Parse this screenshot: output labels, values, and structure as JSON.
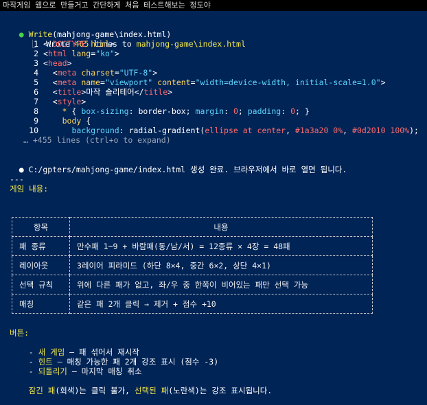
{
  "window": {
    "title": "마작게임 웹으로 만들거고 간단하게 처음 테스트해보는 정도야"
  },
  "tool_call": {
    "name": "Write",
    "arg": "mahjong-game\\index.html",
    "result_prefix": "Wrote ",
    "result_count": "465",
    "result_mid": " lines to ",
    "result_path": "mahjong-game\\index.html"
  },
  "code_lines": [
    {
      "n": "1",
      "parts": [
        {
          "t": "<!",
          "c": "w"
        },
        {
          "t": "DOCTYPE",
          "c": "kw"
        },
        {
          "t": " html",
          "c": "attr"
        },
        {
          "t": ">",
          "c": "w"
        }
      ]
    },
    {
      "n": "2",
      "parts": [
        {
          "t": "<",
          "c": "w"
        },
        {
          "t": "html",
          "c": "kw"
        },
        {
          "t": " lang",
          "c": "attr"
        },
        {
          "t": "=",
          "c": "w"
        },
        {
          "t": "\"ko\"",
          "c": "str"
        },
        {
          "t": ">",
          "c": "w"
        }
      ]
    },
    {
      "n": "3",
      "parts": [
        {
          "t": "<",
          "c": "w"
        },
        {
          "t": "head",
          "c": "kw"
        },
        {
          "t": ">",
          "c": "w"
        }
      ]
    },
    {
      "n": "4",
      "parts": [
        {
          "t": "  <",
          "c": "w"
        },
        {
          "t": "meta",
          "c": "kw"
        },
        {
          "t": " charset",
          "c": "attr"
        },
        {
          "t": "=",
          "c": "w"
        },
        {
          "t": "\"UTF-8\"",
          "c": "str"
        },
        {
          "t": ">",
          "c": "w"
        }
      ]
    },
    {
      "n": "5",
      "parts": [
        {
          "t": "  <",
          "c": "w"
        },
        {
          "t": "meta",
          "c": "kw"
        },
        {
          "t": " name",
          "c": "attr"
        },
        {
          "t": "=",
          "c": "w"
        },
        {
          "t": "\"viewport\"",
          "c": "str"
        },
        {
          "t": " content",
          "c": "attr"
        },
        {
          "t": "=",
          "c": "w"
        },
        {
          "t": "\"width=device-width, initial-scale=1.0\"",
          "c": "str"
        },
        {
          "t": ">",
          "c": "w"
        }
      ]
    },
    {
      "n": "6",
      "parts": [
        {
          "t": "  <",
          "c": "w"
        },
        {
          "t": "title",
          "c": "kw"
        },
        {
          "t": ">마작 솔리테어</",
          "c": "w"
        },
        {
          "t": "title",
          "c": "kw"
        },
        {
          "t": ">",
          "c": "w"
        }
      ]
    },
    {
      "n": "7",
      "parts": [
        {
          "t": "  <",
          "c": "w"
        },
        {
          "t": "style",
          "c": "kw"
        },
        {
          "t": ">",
          "c": "w"
        }
      ]
    },
    {
      "n": "8",
      "parts": [
        {
          "t": "    * ",
          "c": "sel"
        },
        {
          "t": "{ ",
          "c": "w"
        },
        {
          "t": "box-sizing",
          "c": "prop"
        },
        {
          "t": ": border-box; ",
          "c": "w"
        },
        {
          "t": "margin",
          "c": "prop"
        },
        {
          "t": ": ",
          "c": "w"
        },
        {
          "t": "0",
          "c": "red"
        },
        {
          "t": "; ",
          "c": "w"
        },
        {
          "t": "padding",
          "c": "prop"
        },
        {
          "t": ": ",
          "c": "w"
        },
        {
          "t": "0",
          "c": "red"
        },
        {
          "t": "; }",
          "c": "w"
        }
      ]
    },
    {
      "n": "9",
      "parts": [
        {
          "t": "    body",
          "c": "sel"
        },
        {
          "t": " {",
          "c": "w"
        }
      ]
    },
    {
      "n": "10",
      "parts": [
        {
          "t": "      ",
          "c": "w"
        },
        {
          "t": "background",
          "c": "prop"
        },
        {
          "t": ": radial-gradient(",
          "c": "w"
        },
        {
          "t": "ellipse at center",
          "c": "red"
        },
        {
          "t": ", ",
          "c": "w"
        },
        {
          "t": "#1a3a20 0%",
          "c": "red"
        },
        {
          "t": ", ",
          "c": "w"
        },
        {
          "t": "#0d2010 100%",
          "c": "red"
        },
        {
          "t": ");",
          "c": "w"
        }
      ]
    }
  ],
  "more_lines": "… +455 lines (ctrl+o to expand)",
  "status_line": {
    "path": "C:/gpters/mahjong-game/index.html",
    "text": " 생성 완료. 브라우저에서 바로 열면 됩니다."
  },
  "separator": "---",
  "game_heading": "게임 내용:",
  "table": {
    "headers": [
      "항목",
      "내용"
    ],
    "rows": [
      [
        "패 종류",
        "만수패 1~9 + 바람패(동/남/서) = 12종류 × 4장 = 48패"
      ],
      [
        "레이아웃",
        "3레이어 피라미드 (하단 8×4, 중간 6×2, 상단 4×1)"
      ],
      [
        "선택 규칙",
        "위에 다른 패가 없고, 좌/우 중 한쪽이 비어있는 패만 선택 가능"
      ],
      [
        "매칭",
        "같은 패 2개 클릭 → 제거 + 점수 +10"
      ]
    ]
  },
  "buttons_heading": "버튼:",
  "buttons": [
    {
      "bullet": "- ",
      "name": "새 게임",
      "desc": " — 패 섞어서 재시작"
    },
    {
      "bullet": "- ",
      "name": "힌트",
      "desc": " — 매칭 가능한 패 2개 강조 표시 (점수 -3)"
    },
    {
      "bullet": "- ",
      "name": "되돌리기",
      "desc": " — 마지막 매칭 취소"
    }
  ],
  "footer": {
    "p1": "잠긴 패",
    "p2": "(회색)는 클릭 불가, ",
    "p3": "선택된 패",
    "p4": "(노란색)는 강조 표시됩니다."
  }
}
